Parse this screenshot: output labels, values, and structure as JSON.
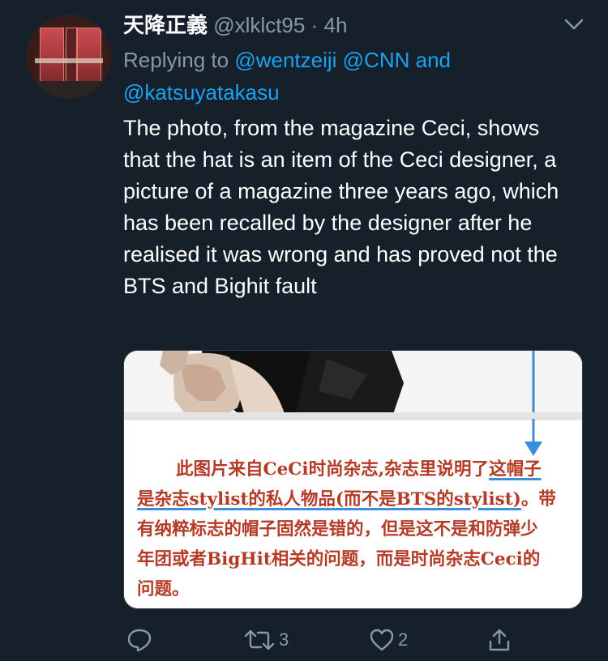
{
  "colors": {
    "background": "#15202b",
    "text": "#ffffff",
    "muted": "#8899a6",
    "link": "#1da1f2",
    "caption_red": "#b53a26",
    "annotation_blue": "#3b8fd9"
  },
  "tweet": {
    "display_name": "天降正義",
    "handle": "@xlklct95",
    "separator": "·",
    "time": "4h",
    "replying_prefix": "Replying to",
    "mentions": [
      "@wentzeiji",
      "@CNN",
      "@katsuyatakasu"
    ],
    "mention_joiner": "and",
    "text": "The photo, from the magazine Ceci, shows that the hat is an item of the Ceci designer, a picture of a magazine three years ago, which has been recalled by the designer after he realised it was wrong and has proved not the BTS and Bighit fault"
  },
  "media": {
    "caption_lines": [
      {
        "pre": "此图片来自CeCi时尚杂志,杂志里说明了",
        "underlined": "这帽子"
      },
      {
        "pre": "",
        "underlined": "是杂志stylist的私人物品(而不是BTS的stylist)",
        "post": "。带"
      },
      {
        "pre": "有纳粹标志的帽子固然是错的，但是这不是和防弹少"
      },
      {
        "pre": "年团或者BigHit相关的问题，而是时尚杂志Ceci的"
      },
      {
        "pre": "问题。"
      }
    ]
  },
  "actions": {
    "reply_icon": "reply-icon",
    "retweet_icon": "retweet-icon",
    "retweet_count": "3",
    "like_icon": "heart-icon",
    "like_count": "2",
    "share_icon": "share-icon"
  }
}
